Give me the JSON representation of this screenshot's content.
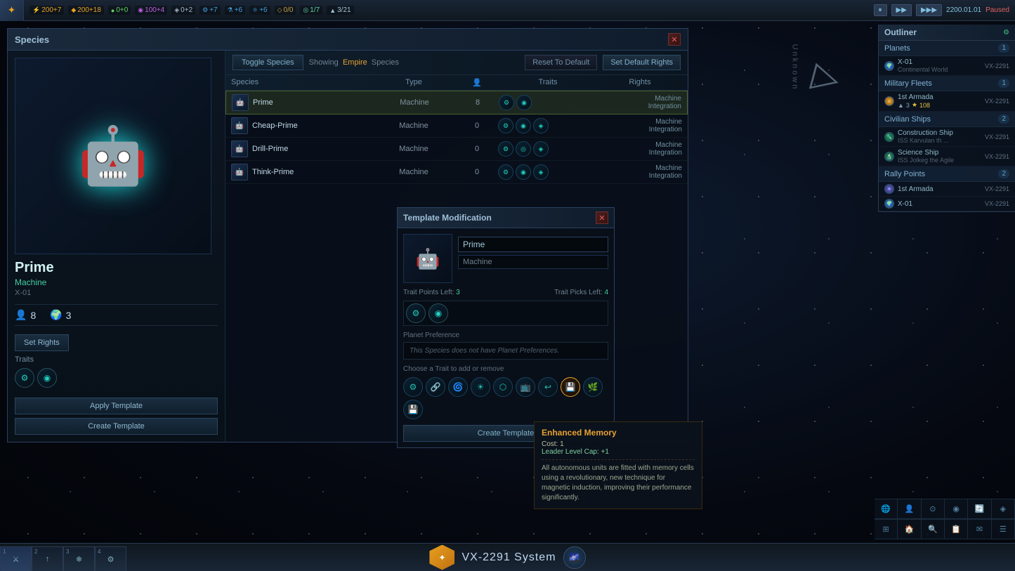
{
  "app": {
    "title": "Stellaris"
  },
  "topbar": {
    "resources": [
      {
        "id": "energy",
        "icon": "⚡",
        "value": "200+7",
        "color": "#40d0e0"
      },
      {
        "id": "minerals",
        "icon": "◆",
        "value": "200+18",
        "color": "#e8a020"
      },
      {
        "id": "food",
        "icon": "●",
        "value": "0+0",
        "color": "#60d060"
      },
      {
        "id": "consumer",
        "icon": "◉",
        "value": "100+4",
        "color": "#c060e0"
      },
      {
        "id": "alloys",
        "icon": "◈",
        "value": "0+2",
        "color": "#a0b8c8"
      },
      {
        "id": "research1",
        "icon": "⚙",
        "value": "+7",
        "color": "#40a0e0"
      },
      {
        "id": "research2",
        "icon": "⚗",
        "value": "+6",
        "color": "#40a0e0"
      },
      {
        "id": "research3",
        "icon": "⚛",
        "value": "+6",
        "color": "#40a0e0"
      },
      {
        "id": "unity",
        "icon": "◇",
        "value": "0/0",
        "color": "#c0a040"
      },
      {
        "id": "influence",
        "icon": "◎",
        "value": "1/7",
        "color": "#60d0a0"
      },
      {
        "id": "pops",
        "icon": "▲",
        "value": "3/21",
        "color": "#a0c0d8"
      }
    ],
    "pause_btn": "⏸",
    "date": "2200.01.01",
    "paused": "Paused",
    "speed_fwd": "▶▶",
    "speed_skip": "▶▶▶"
  },
  "species_window": {
    "title": "Species",
    "toggle_btn": "Toggle Species",
    "showing_label": "Showing",
    "empire_label": "Empire",
    "species_label": "Species",
    "reset_btn": "Reset To Default",
    "set_rights_btn": "Set Default Rights",
    "table_headers": [
      "Species",
      "Type",
      "👤",
      "Traits",
      "Rights"
    ],
    "species_list": [
      {
        "name": "Prime",
        "type": "Machine",
        "count": "8",
        "rights": "Machine\nIntegration",
        "selected": true
      },
      {
        "name": "Cheap-Prime",
        "type": "Machine",
        "count": "0",
        "rights": "Machine\nIntegration",
        "selected": false
      },
      {
        "name": "Drill-Prime",
        "type": "Machine",
        "count": "0",
        "rights": "Machine\nIntegration",
        "selected": false
      },
      {
        "name": "Think-Prime",
        "type": "Machine",
        "count": "0",
        "rights": "Machine\nIntegration",
        "selected": false
      }
    ],
    "left_panel": {
      "name": "Prime",
      "type": "Machine",
      "id": "X-01",
      "pop_count": "8",
      "colony_count": "3",
      "set_rights_btn": "Set Rights",
      "traits_label": "Traits",
      "apply_template_btn": "Apply Template",
      "create_template_btn": "Create Template"
    }
  },
  "template_dialog": {
    "title": "Template Modification",
    "species_name": "Prime",
    "species_type": "Machine",
    "trait_points_label": "Trait Points Left:",
    "trait_points_val": "3",
    "trait_picks_label": "Trait Picks Left:",
    "trait_picks_val": "4",
    "planet_pref_label": "Planet Preference",
    "planet_pref_text": "This Species does not have Planet Preferences.",
    "choose_trait_label": "Choose a Trait to add or remove",
    "create_btn": "Create Template"
  },
  "tooltip": {
    "title": "Enhanced Memory",
    "cost_label": "Cost:",
    "cost_val": "1",
    "stat_label": "Leader Level Cap:",
    "stat_val": "+1",
    "description": "All autonomous units are fitted with memory cells using a revolutionary, new technique for magnetic induction, improving their performance significantly."
  },
  "outliner": {
    "title": "Outliner",
    "sections": [
      {
        "id": "planets",
        "title": "Planets",
        "count": "1",
        "items": [
          {
            "name": "X-01",
            "sub": "Continental World",
            "loc": "VX-2291"
          }
        ]
      },
      {
        "id": "military-fleets",
        "title": "Military Fleets",
        "count": "1",
        "items": [
          {
            "name": "1st Armada",
            "power": "108",
            "fleets": "3",
            "loc": "VX-2291"
          }
        ]
      },
      {
        "id": "civilian-ships",
        "title": "Civilian Ships",
        "count": "2",
        "items": [
          {
            "name": "Construction Ship",
            "sub": "ISS Karvulan th ...",
            "loc": "VX-2291"
          },
          {
            "name": "Science Ship",
            "sub": "ISS Jolkeg the Agile",
            "loc": "VX-2291"
          }
        ]
      },
      {
        "id": "rally-points",
        "title": "Rally Points",
        "count": "2",
        "items": [
          {
            "name": "1st Armada",
            "loc": "VX-2291"
          },
          {
            "name": "X-01",
            "loc": "VX-2291"
          }
        ]
      }
    ]
  },
  "bottom_system": {
    "name": "VX-2291 System"
  },
  "bottom_tabs": [
    {
      "num": "1",
      "icon": "⚔"
    },
    {
      "num": "2",
      "icon": "↑"
    },
    {
      "num": "3",
      "icon": "❄"
    },
    {
      "num": "4",
      "icon": "⚙"
    }
  ],
  "bottom_right_nav": {
    "rows": [
      [
        "🌐",
        "👤",
        "⊙",
        "◉",
        "🔄",
        "◈"
      ],
      [
        "⊞",
        "🏠",
        "🔍",
        "📋",
        "✉",
        "☰"
      ]
    ]
  }
}
